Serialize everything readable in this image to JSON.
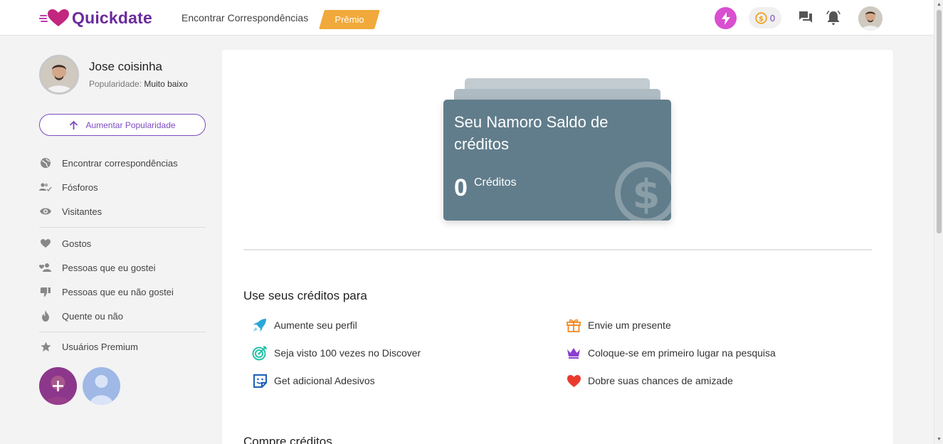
{
  "header": {
    "brand": "Quickdate",
    "nav_link": "Encontrar Correspondências",
    "premium_label": "Prêmio",
    "credits_count": "0"
  },
  "sidebar": {
    "user_name": "Jose coisinha",
    "popularity_label": "Popularidade:",
    "popularity_value": "Muito baixo",
    "boost_button": "Aumentar Popularidade",
    "items": [
      {
        "label": "Encontrar correspondências",
        "icon": "globe-icon"
      },
      {
        "label": "Fósforos",
        "icon": "people-check-icon"
      },
      {
        "label": "Visitantes",
        "icon": "eye-icon"
      },
      {
        "label": "Gostos",
        "icon": "heart-icon"
      },
      {
        "label": "Pessoas que eu gostei",
        "icon": "people-heart-icon"
      },
      {
        "label": "Pessoas que eu não gostei",
        "icon": "thumbs-down-icon"
      },
      {
        "label": "Quente ou não",
        "icon": "flame-icon"
      },
      {
        "label": "Usuários Premium",
        "icon": "star-icon"
      }
    ]
  },
  "main": {
    "balance_title": "Seu Namoro Saldo de créditos",
    "balance_value": "0",
    "balance_unit": "Créditos",
    "use_title": "Use seus créditos para",
    "use_items": [
      {
        "label": "Aumente seu perfil",
        "icon": "rocket-icon"
      },
      {
        "label": "Envie um presente",
        "icon": "gift-icon"
      },
      {
        "label": "Seja visto 100 vezes no Discover",
        "icon": "target-icon"
      },
      {
        "label": "Coloque-se em primeiro lugar na pesquisa",
        "icon": "crown-icon"
      },
      {
        "label": "Get adicional Adesivos",
        "icon": "sticker-icon"
      },
      {
        "label": "Dobre suas chances de amizade",
        "icon": "heart-red-icon"
      }
    ],
    "buy_title": "Compre créditos"
  },
  "colors": {
    "brand": "#6a2b9b",
    "premium": "#f0a93a",
    "boost": "#d94fd0",
    "balance_card": "#617d8b"
  }
}
